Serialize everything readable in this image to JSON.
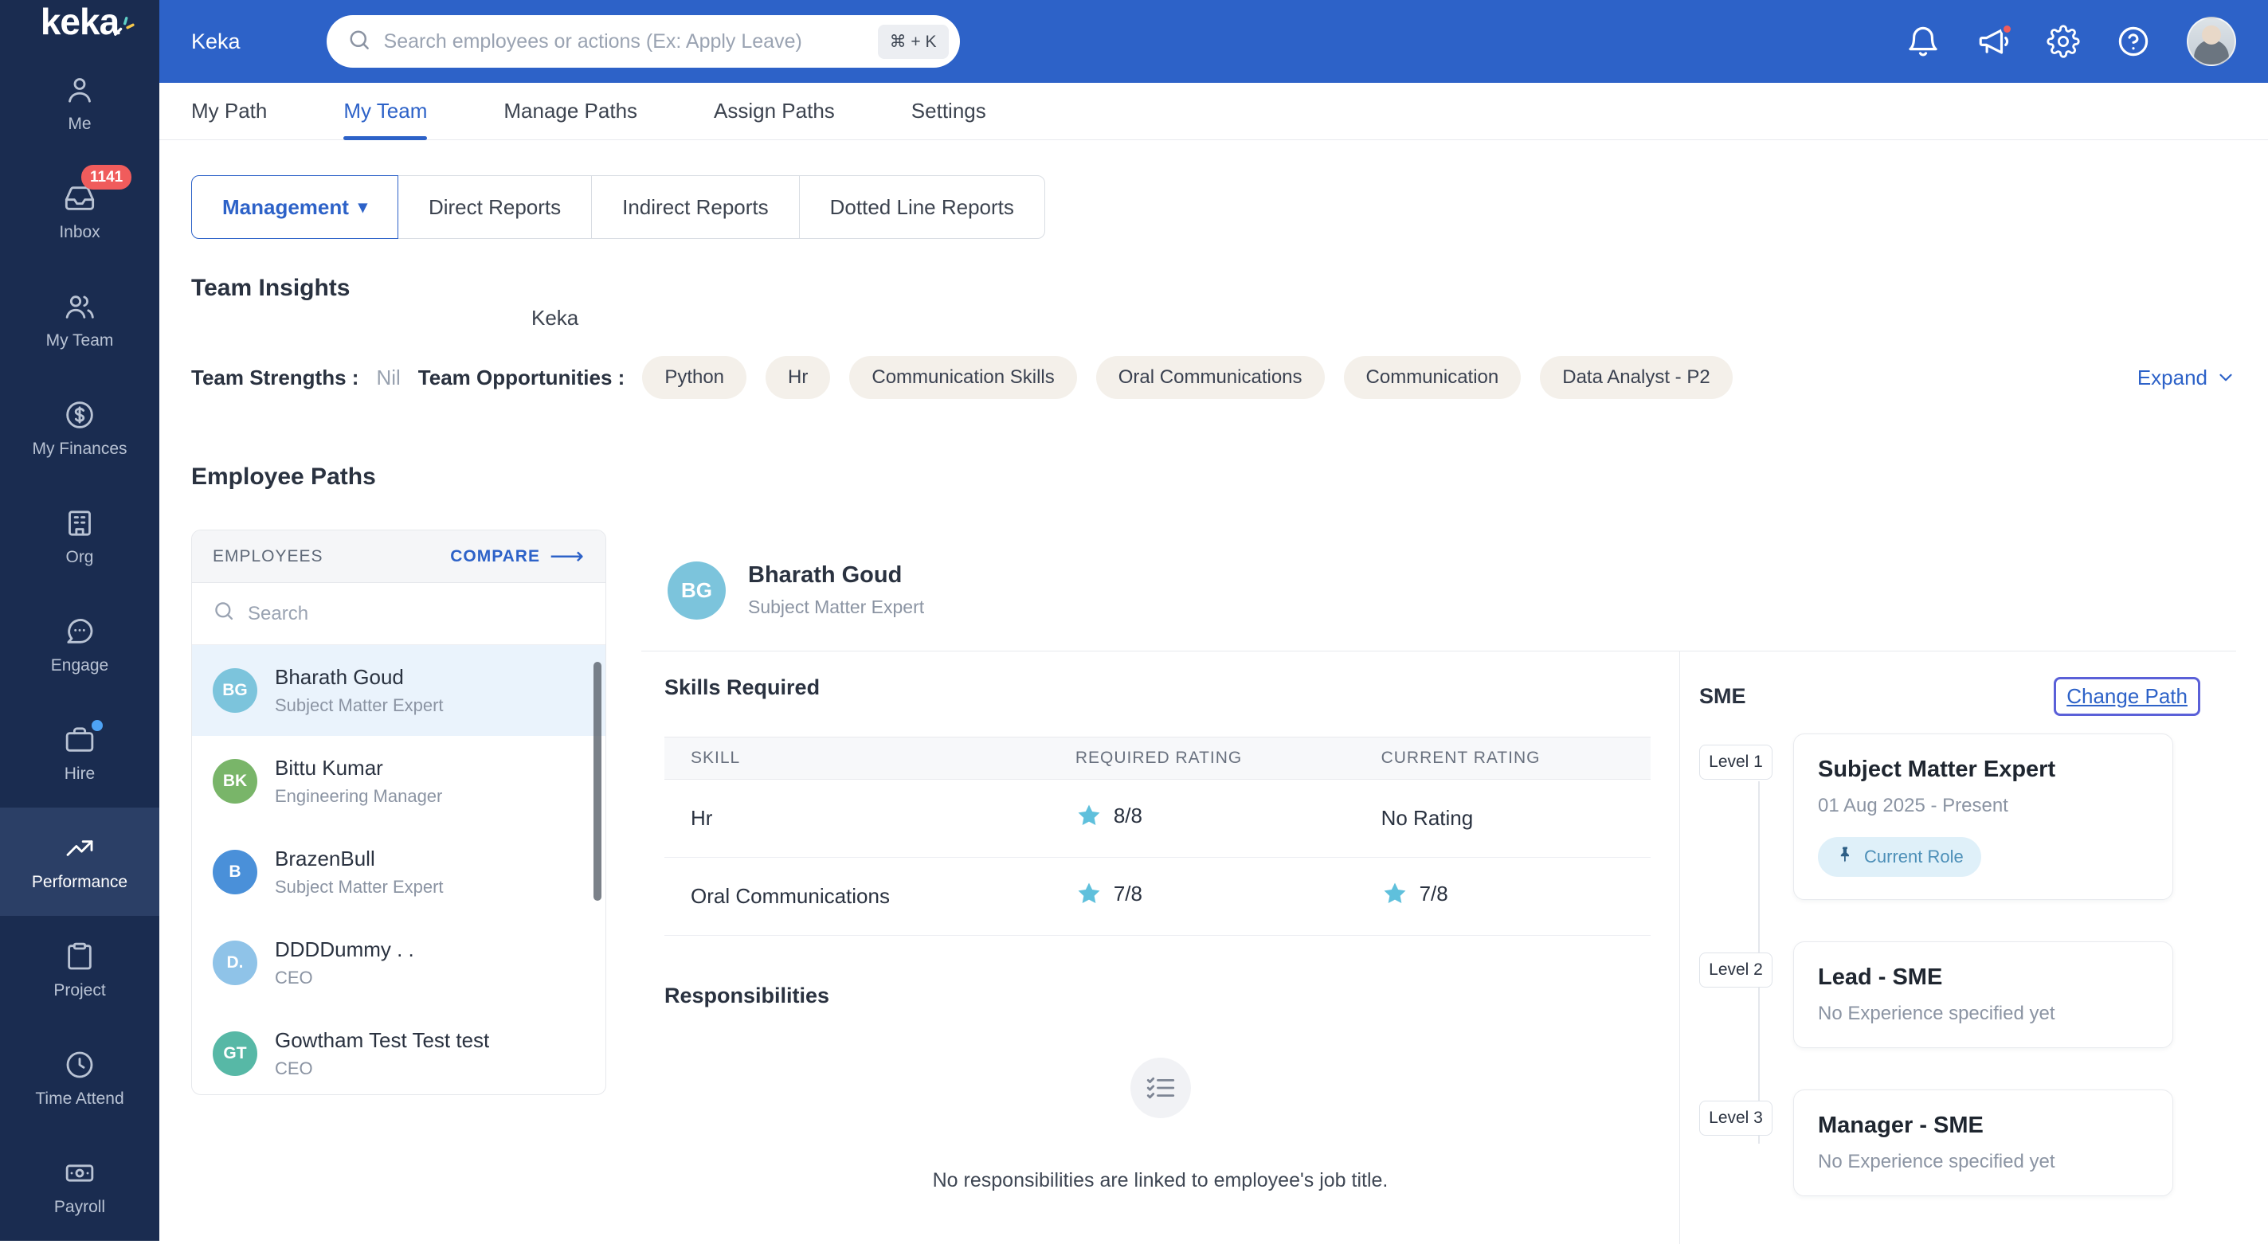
{
  "colors": {
    "accent": "#2d62c8",
    "sidebar": "#1a2c50",
    "star": "#5fc0dc",
    "badge_red": "#f05c5c",
    "selected_row": "#eaf3fc"
  },
  "header": {
    "app_label": "Keka",
    "search": {
      "placeholder": "Search employees or actions (Ex: Apply Leave)",
      "shortcut": "⌘ + K"
    }
  },
  "sidebar": {
    "logo": "keka",
    "items": [
      {
        "label": "Me",
        "icon": "user"
      },
      {
        "label": "Inbox",
        "icon": "inbox",
        "badge": "1141"
      },
      {
        "label": "My Team",
        "icon": "team"
      },
      {
        "label": "My Finances",
        "icon": "finances"
      },
      {
        "label": "Org",
        "icon": "org"
      },
      {
        "label": "Engage",
        "icon": "engage"
      },
      {
        "label": "Hire",
        "icon": "hire",
        "dot": true
      },
      {
        "label": "Performance",
        "icon": "performance",
        "active": true
      },
      {
        "label": "Project",
        "icon": "project"
      },
      {
        "label": "Time Attend",
        "icon": "time"
      },
      {
        "label": "Payroll",
        "icon": "payroll"
      }
    ]
  },
  "tabs": [
    {
      "label": "My Path"
    },
    {
      "label": "My Team",
      "active": true
    },
    {
      "label": "Manage Paths"
    },
    {
      "label": "Assign Paths"
    },
    {
      "label": "Settings"
    }
  ],
  "report_tabs": [
    {
      "label": "Management",
      "active": true,
      "dropdown": true
    },
    {
      "label": "Direct Reports"
    },
    {
      "label": "Indirect Reports"
    },
    {
      "label": "Dotted Line Reports"
    }
  ],
  "team_insights": {
    "title": "Team Insights",
    "org": "Keka",
    "strengths_label": "Team Strengths :",
    "strengths_value": "Nil",
    "opportunities_label": "Team Opportunities :",
    "opportunities": [
      "Python",
      "Hr",
      "Communication Skills",
      "Oral Communications",
      "Communication",
      "Data Analyst - P2"
    ],
    "expand_label": "Expand"
  },
  "employee_paths": {
    "title": "Employee Paths",
    "panel": {
      "header": "EMPLOYEES",
      "compare": "COMPARE",
      "search_placeholder": "Search",
      "employees": [
        {
          "initials": "BG",
          "name": "Bharath Goud",
          "role": "Subject Matter Expert",
          "color": "#7cc4dc",
          "selected": true
        },
        {
          "initials": "BK",
          "name": "Bittu Kumar",
          "role": "Engineering Manager",
          "color": "#79b569"
        },
        {
          "initials": "B",
          "name": "BrazenBull",
          "role": "Subject Matter Expert",
          "color": "#4a90d9"
        },
        {
          "initials": "D.",
          "name": "DDDDummy . .",
          "role": "CEO",
          "color": "#8fc3e8"
        },
        {
          "initials": "GT",
          "name": "Gowtham Test Test test",
          "role": "CEO",
          "color": "#57b8a6"
        }
      ]
    },
    "detail": {
      "initials": "BG",
      "name": "Bharath Goud",
      "role": "Subject Matter Expert",
      "skills": {
        "title": "Skills Required",
        "columns": [
          "SKILL",
          "REQUIRED RATING",
          "CURRENT RATING"
        ],
        "rows": [
          {
            "skill": "Hr",
            "required": "8/8",
            "current": "No Rating",
            "current_star": false
          },
          {
            "skill": "Oral Communications",
            "required": "7/8",
            "current": "7/8",
            "current_star": true
          }
        ]
      },
      "responsibilities": {
        "title": "Responsibilities",
        "empty_text": "No responsibilities are linked to employee's job title."
      }
    },
    "path": {
      "title": "SME",
      "change_path": "Change Path",
      "levels": [
        {
          "level": "Level 1",
          "role": "Subject Matter Expert",
          "duration": "01 Aug 2025 - Present",
          "badge": "Current Role"
        },
        {
          "level": "Level 2",
          "role": "Lead - SME",
          "duration": "No Experience specified yet"
        },
        {
          "level": "Level 3",
          "role": "Manager - SME",
          "duration": "No Experience specified yet"
        }
      ]
    }
  }
}
